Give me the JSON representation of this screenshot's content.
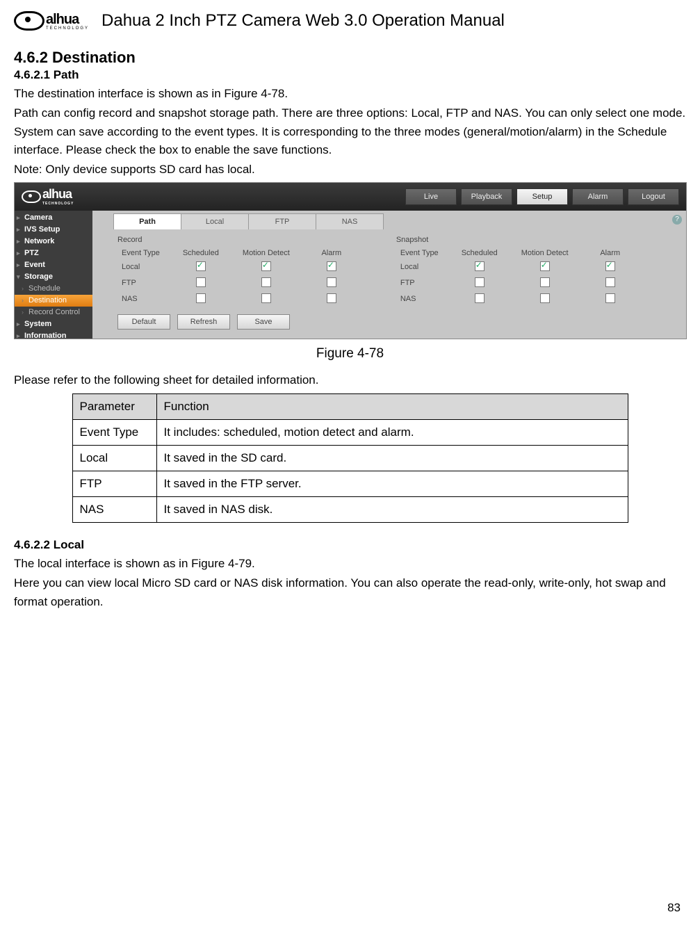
{
  "header": {
    "logo_text": "alhua",
    "logo_sub": "TECHNOLOGY",
    "doc_title": "Dahua 2 Inch PTZ Camera Web 3.0 Operation Manual"
  },
  "section": {
    "num_title": "4.6.2   Destination",
    "sub1_num_title": "4.6.2.1 Path",
    "p1": "The destination interface is shown as in Figure 4-78.",
    "p2": "Path can config record and snapshot storage path. There are three options: Local, FTP and NAS. You can only select one mode. System can save according to the event types. It is corresponding to the three modes (general/motion/alarm) in the Schedule interface. Please check the box to enable the save functions.",
    "p3": "Note: Only device supports SD card has local.",
    "fig_caption": "Figure 4-78",
    "p4": "Please refer to the following sheet for detailed information.",
    "sub2_num_title": "4.6.2.2 Local",
    "p5": "The local interface is shown as in Figure 4-79.",
    "p6": "Here you can view local Micro SD card or NAS disk information. You can also operate the read-only, write-only, hot swap and format operation."
  },
  "param_table": {
    "head": [
      "Parameter",
      "Function"
    ],
    "rows": [
      [
        "Event Type",
        "It includes: scheduled, motion detect and alarm."
      ],
      [
        "Local",
        "It saved in the SD card."
      ],
      [
        "FTP",
        "It saved in the FTP server."
      ],
      [
        "NAS",
        "It saved in NAS disk."
      ]
    ]
  },
  "screenshot": {
    "logo_text": "alhua",
    "logo_sub": "TECHNOLOGY",
    "top_tabs": [
      "Live",
      "Playback",
      "Setup",
      "Alarm",
      "Logout"
    ],
    "top_active": "Setup",
    "sidebar": [
      {
        "label": "Camera",
        "type": "top"
      },
      {
        "label": "IVS Setup",
        "type": "top"
      },
      {
        "label": "Network",
        "type": "top"
      },
      {
        "label": "PTZ",
        "type": "top"
      },
      {
        "label": "Event",
        "type": "top"
      },
      {
        "label": "Storage",
        "type": "top open"
      },
      {
        "label": "Schedule",
        "type": "child"
      },
      {
        "label": "Destination",
        "type": "child sel"
      },
      {
        "label": "Record Control",
        "type": "child"
      },
      {
        "label": "System",
        "type": "top"
      },
      {
        "label": "Information",
        "type": "top"
      }
    ],
    "inner_tabs": [
      "Path",
      "Local",
      "FTP",
      "NAS"
    ],
    "inner_active": "Path",
    "help": "?",
    "record_title": "Record",
    "snapshot_title": "Snapshot",
    "col_headers": [
      "Event Type",
      "Scheduled",
      "Motion Detect",
      "Alarm"
    ],
    "rows": [
      {
        "label": "Local",
        "vals": [
          true,
          true,
          true
        ]
      },
      {
        "label": "FTP",
        "vals": [
          false,
          false,
          false
        ]
      },
      {
        "label": "NAS",
        "vals": [
          false,
          false,
          false
        ]
      }
    ],
    "buttons": [
      "Default",
      "Refresh",
      "Save"
    ]
  },
  "page_number": "83"
}
